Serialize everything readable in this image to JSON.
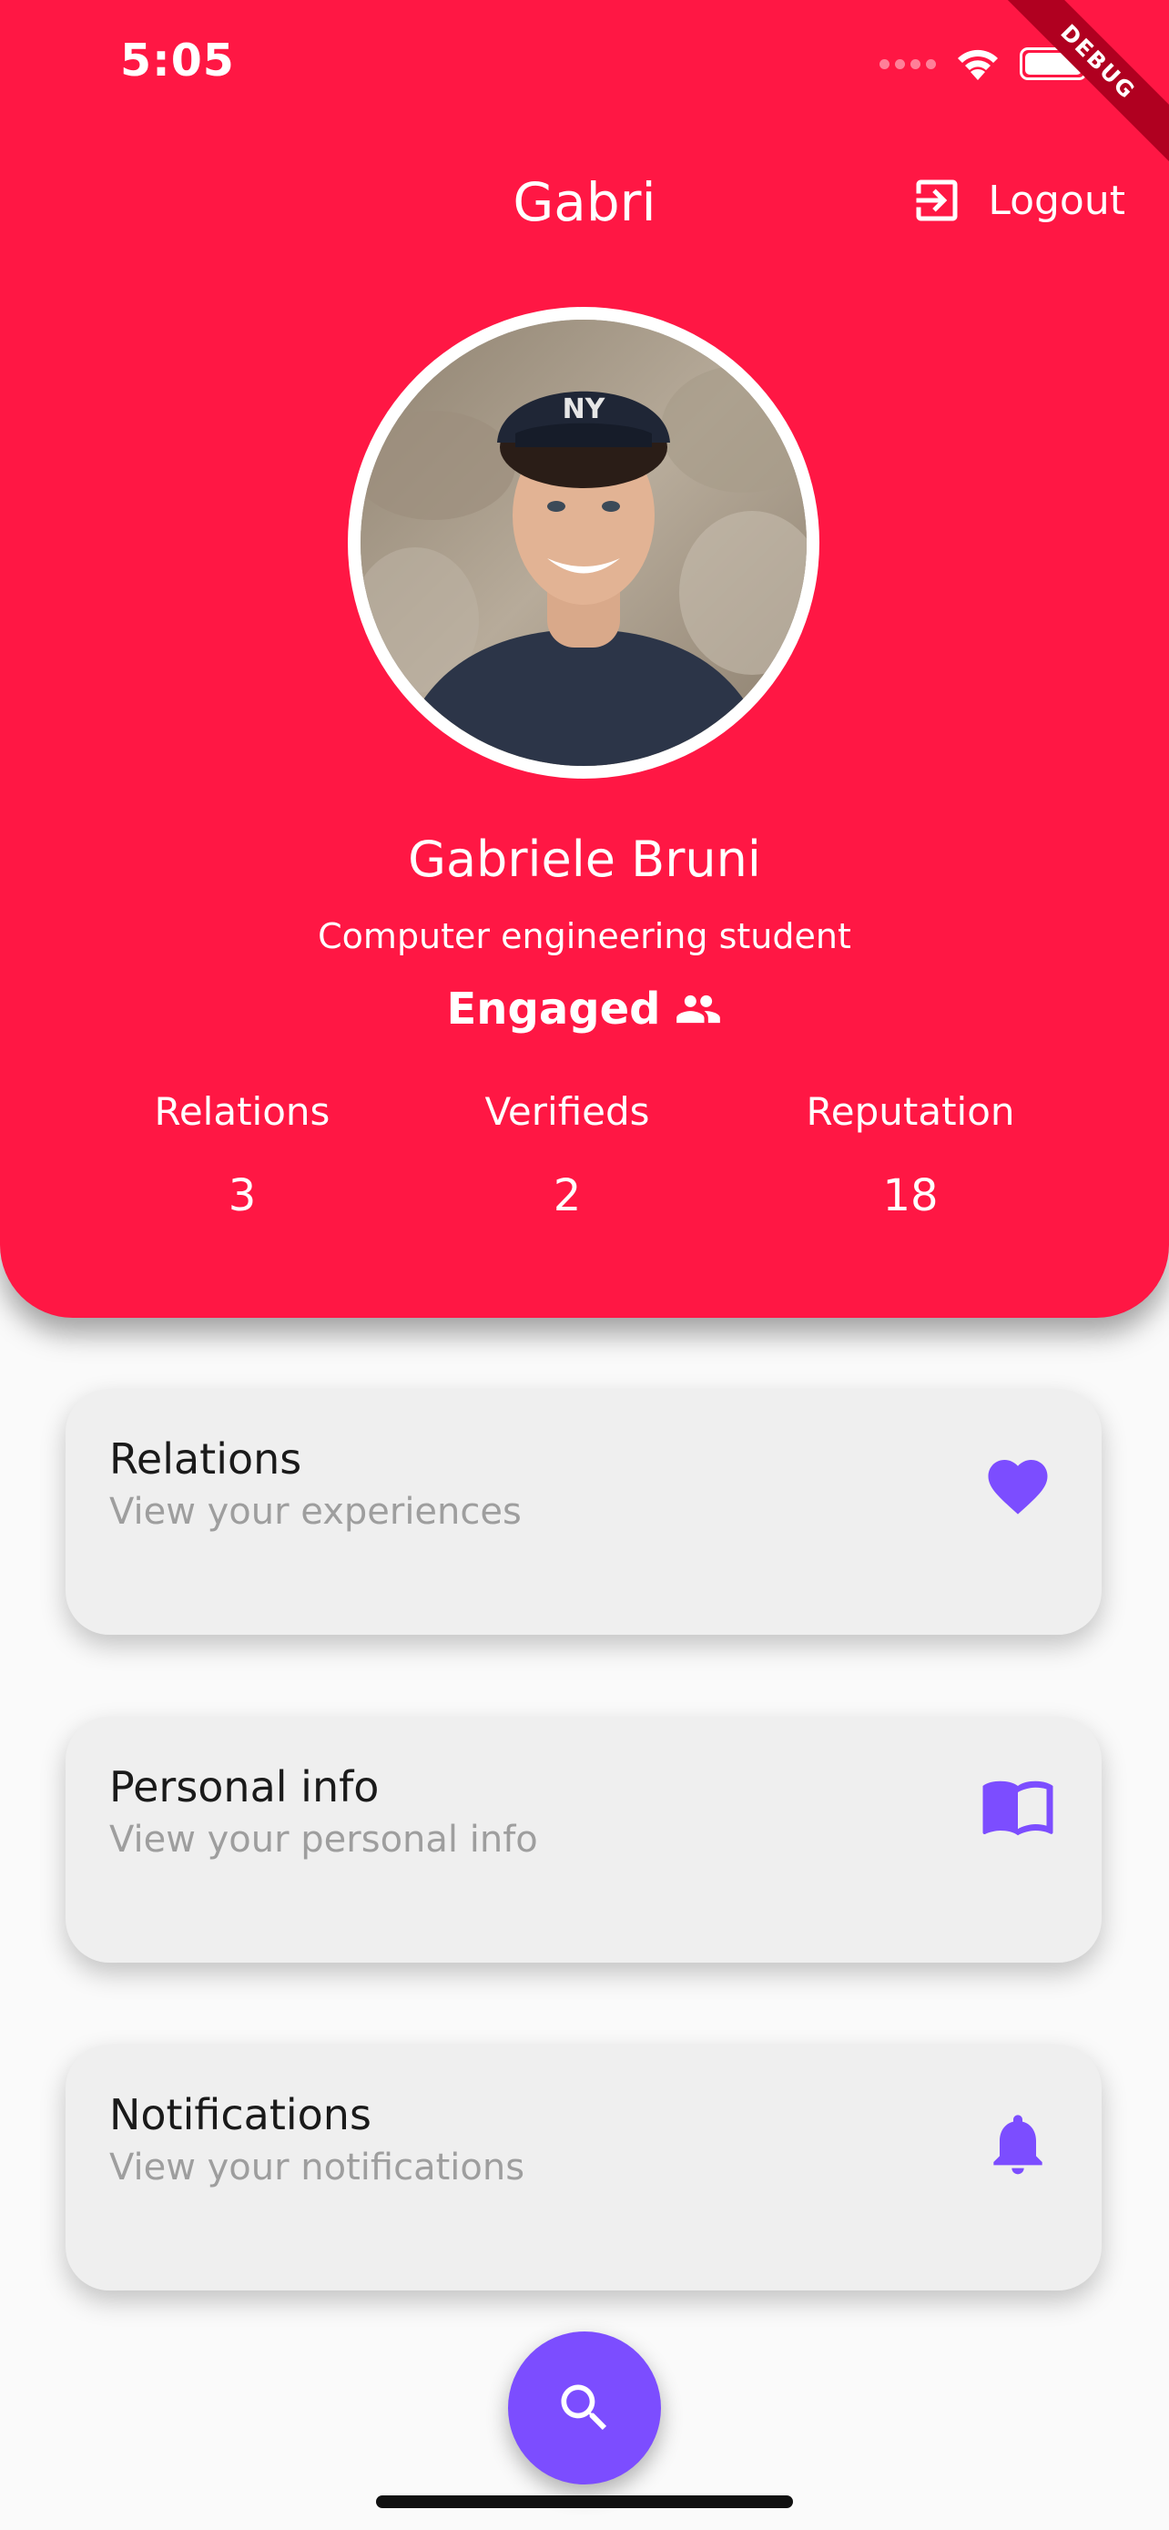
{
  "status_bar": {
    "time": "5:05"
  },
  "debug_banner": "DEBUG",
  "header": {
    "title": "Gabri",
    "logout_label": "Logout",
    "background_color": "#ff1744"
  },
  "profile": {
    "name": "Gabriele Bruni",
    "bio": "Computer engineering student",
    "relationship_status": "Engaged",
    "status_icon": "people-icon"
  },
  "stats": [
    {
      "label": "Relations",
      "value": "3"
    },
    {
      "label": "Verifieds",
      "value": "2"
    },
    {
      "label": "Reputation",
      "value": "18"
    }
  ],
  "cards": [
    {
      "title": "Relations",
      "subtitle": "View your experiences",
      "icon": "heart-icon"
    },
    {
      "title": "Personal info",
      "subtitle": "View your personal info",
      "icon": "book-icon"
    },
    {
      "title": "Notifications",
      "subtitle": "View your notifications",
      "icon": "bell-icon"
    }
  ],
  "fab": {
    "icon": "search-icon",
    "color": "#7c4dff"
  },
  "accent_color": "#7c4dff"
}
